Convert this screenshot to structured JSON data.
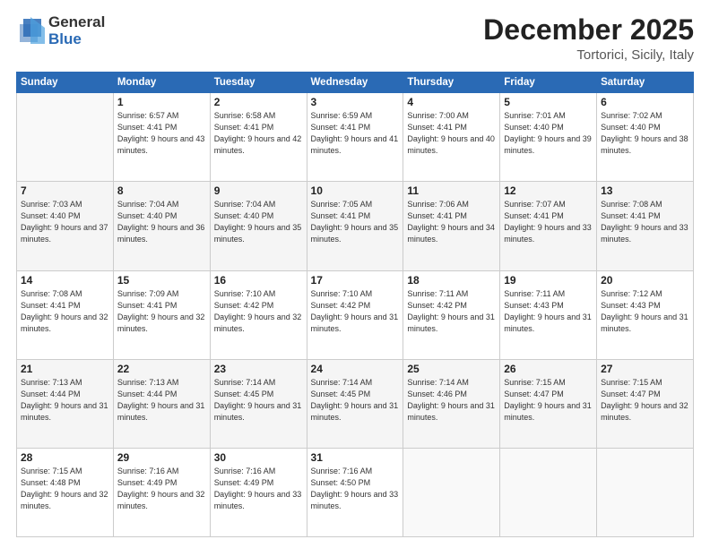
{
  "logo": {
    "general": "General",
    "blue": "Blue"
  },
  "title": {
    "month": "December 2025",
    "location": "Tortorici, Sicily, Italy"
  },
  "header_days": [
    "Sunday",
    "Monday",
    "Tuesday",
    "Wednesday",
    "Thursday",
    "Friday",
    "Saturday"
  ],
  "weeks": [
    [
      {
        "day": "",
        "sunrise": "",
        "sunset": "",
        "daylight": ""
      },
      {
        "day": "1",
        "sunrise": "Sunrise: 6:57 AM",
        "sunset": "Sunset: 4:41 PM",
        "daylight": "Daylight: 9 hours and 43 minutes."
      },
      {
        "day": "2",
        "sunrise": "Sunrise: 6:58 AM",
        "sunset": "Sunset: 4:41 PM",
        "daylight": "Daylight: 9 hours and 42 minutes."
      },
      {
        "day": "3",
        "sunrise": "Sunrise: 6:59 AM",
        "sunset": "Sunset: 4:41 PM",
        "daylight": "Daylight: 9 hours and 41 minutes."
      },
      {
        "day": "4",
        "sunrise": "Sunrise: 7:00 AM",
        "sunset": "Sunset: 4:41 PM",
        "daylight": "Daylight: 9 hours and 40 minutes."
      },
      {
        "day": "5",
        "sunrise": "Sunrise: 7:01 AM",
        "sunset": "Sunset: 4:40 PM",
        "daylight": "Daylight: 9 hours and 39 minutes."
      },
      {
        "day": "6",
        "sunrise": "Sunrise: 7:02 AM",
        "sunset": "Sunset: 4:40 PM",
        "daylight": "Daylight: 9 hours and 38 minutes."
      }
    ],
    [
      {
        "day": "7",
        "sunrise": "Sunrise: 7:03 AM",
        "sunset": "Sunset: 4:40 PM",
        "daylight": "Daylight: 9 hours and 37 minutes."
      },
      {
        "day": "8",
        "sunrise": "Sunrise: 7:04 AM",
        "sunset": "Sunset: 4:40 PM",
        "daylight": "Daylight: 9 hours and 36 minutes."
      },
      {
        "day": "9",
        "sunrise": "Sunrise: 7:04 AM",
        "sunset": "Sunset: 4:40 PM",
        "daylight": "Daylight: 9 hours and 35 minutes."
      },
      {
        "day": "10",
        "sunrise": "Sunrise: 7:05 AM",
        "sunset": "Sunset: 4:41 PM",
        "daylight": "Daylight: 9 hours and 35 minutes."
      },
      {
        "day": "11",
        "sunrise": "Sunrise: 7:06 AM",
        "sunset": "Sunset: 4:41 PM",
        "daylight": "Daylight: 9 hours and 34 minutes."
      },
      {
        "day": "12",
        "sunrise": "Sunrise: 7:07 AM",
        "sunset": "Sunset: 4:41 PM",
        "daylight": "Daylight: 9 hours and 33 minutes."
      },
      {
        "day": "13",
        "sunrise": "Sunrise: 7:08 AM",
        "sunset": "Sunset: 4:41 PM",
        "daylight": "Daylight: 9 hours and 33 minutes."
      }
    ],
    [
      {
        "day": "14",
        "sunrise": "Sunrise: 7:08 AM",
        "sunset": "Sunset: 4:41 PM",
        "daylight": "Daylight: 9 hours and 32 minutes."
      },
      {
        "day": "15",
        "sunrise": "Sunrise: 7:09 AM",
        "sunset": "Sunset: 4:41 PM",
        "daylight": "Daylight: 9 hours and 32 minutes."
      },
      {
        "day": "16",
        "sunrise": "Sunrise: 7:10 AM",
        "sunset": "Sunset: 4:42 PM",
        "daylight": "Daylight: 9 hours and 32 minutes."
      },
      {
        "day": "17",
        "sunrise": "Sunrise: 7:10 AM",
        "sunset": "Sunset: 4:42 PM",
        "daylight": "Daylight: 9 hours and 31 minutes."
      },
      {
        "day": "18",
        "sunrise": "Sunrise: 7:11 AM",
        "sunset": "Sunset: 4:42 PM",
        "daylight": "Daylight: 9 hours and 31 minutes."
      },
      {
        "day": "19",
        "sunrise": "Sunrise: 7:11 AM",
        "sunset": "Sunset: 4:43 PM",
        "daylight": "Daylight: 9 hours and 31 minutes."
      },
      {
        "day": "20",
        "sunrise": "Sunrise: 7:12 AM",
        "sunset": "Sunset: 4:43 PM",
        "daylight": "Daylight: 9 hours and 31 minutes."
      }
    ],
    [
      {
        "day": "21",
        "sunrise": "Sunrise: 7:13 AM",
        "sunset": "Sunset: 4:44 PM",
        "daylight": "Daylight: 9 hours and 31 minutes."
      },
      {
        "day": "22",
        "sunrise": "Sunrise: 7:13 AM",
        "sunset": "Sunset: 4:44 PM",
        "daylight": "Daylight: 9 hours and 31 minutes."
      },
      {
        "day": "23",
        "sunrise": "Sunrise: 7:14 AM",
        "sunset": "Sunset: 4:45 PM",
        "daylight": "Daylight: 9 hours and 31 minutes."
      },
      {
        "day": "24",
        "sunrise": "Sunrise: 7:14 AM",
        "sunset": "Sunset: 4:45 PM",
        "daylight": "Daylight: 9 hours and 31 minutes."
      },
      {
        "day": "25",
        "sunrise": "Sunrise: 7:14 AM",
        "sunset": "Sunset: 4:46 PM",
        "daylight": "Daylight: 9 hours and 31 minutes."
      },
      {
        "day": "26",
        "sunrise": "Sunrise: 7:15 AM",
        "sunset": "Sunset: 4:47 PM",
        "daylight": "Daylight: 9 hours and 31 minutes."
      },
      {
        "day": "27",
        "sunrise": "Sunrise: 7:15 AM",
        "sunset": "Sunset: 4:47 PM",
        "daylight": "Daylight: 9 hours and 32 minutes."
      }
    ],
    [
      {
        "day": "28",
        "sunrise": "Sunrise: 7:15 AM",
        "sunset": "Sunset: 4:48 PM",
        "daylight": "Daylight: 9 hours and 32 minutes."
      },
      {
        "day": "29",
        "sunrise": "Sunrise: 7:16 AM",
        "sunset": "Sunset: 4:49 PM",
        "daylight": "Daylight: 9 hours and 32 minutes."
      },
      {
        "day": "30",
        "sunrise": "Sunrise: 7:16 AM",
        "sunset": "Sunset: 4:49 PM",
        "daylight": "Daylight: 9 hours and 33 minutes."
      },
      {
        "day": "31",
        "sunrise": "Sunrise: 7:16 AM",
        "sunset": "Sunset: 4:50 PM",
        "daylight": "Daylight: 9 hours and 33 minutes."
      },
      {
        "day": "",
        "sunrise": "",
        "sunset": "",
        "daylight": ""
      },
      {
        "day": "",
        "sunrise": "",
        "sunset": "",
        "daylight": ""
      },
      {
        "day": "",
        "sunrise": "",
        "sunset": "",
        "daylight": ""
      }
    ]
  ]
}
